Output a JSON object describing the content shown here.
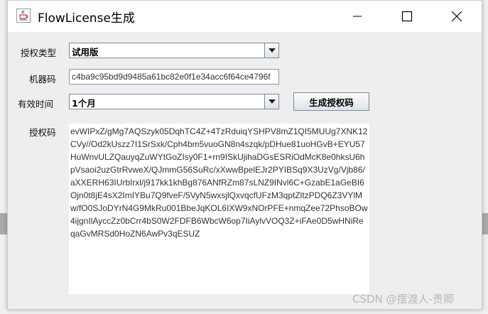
{
  "window": {
    "title": "FlowLicense生成",
    "icon": "java-coffee-icon"
  },
  "form": {
    "license_type": {
      "label": "授权类型",
      "selected": "试用版"
    },
    "machine_code": {
      "label": "机器码",
      "value": "c4ba9c95bd9d9485a61bc82e0f1e34acc6f64ce4796f"
    },
    "validity": {
      "label": "有效时间",
      "selected": "1个月"
    },
    "generate_button": "生成授权码",
    "license_code": {
      "label": "授权码",
      "value": "evWIPxZ/gMg7AQSzyk05DqhTC4Z+4TzRduiqYSHPV8mZ1QI5MUUg7XNK12CVy//Od2kUszz7I1SrSxk/Cph4bm5vuoGN8n4szqk/pDHue81uoHGvB+EYU57HuWnvULZQauyqZuWYtGoZIsy0F1+rn9ISkUjihaDGsESRiOdMcK8e0hksU6hpVsaoi2uzGtrRvweX/QJmmG56SuRc/xXwwBpelEJr2PYIBSq9X3UzVg/Vjb86/aXXERH63IUrbIrxl/j917kk1khBg876ANfRZm87sLNZ9INvl6C+GzabE1aGeBI6Ojn0t8jE4sX2ImIYBu7Q9fveF/5VyN5wxsjlQxvqcfUFzM3qptZltzPDQ6Z3VYlMw/fO0SJoDYrN4G9MkRu001BbeJqKOL6IXW9xNOrPFE+nmqZee72PhsoBOw4ijgnIlAyccZz0bCrr4bS0W2FDFB6WbcW6op7IiAylvVOQ3Z+iFAe0D5wHNiReqaGvMRSd0HoZN6AwPv3qESUZ"
    }
  },
  "watermark": "CSDN @摆渡人-贵卿"
}
